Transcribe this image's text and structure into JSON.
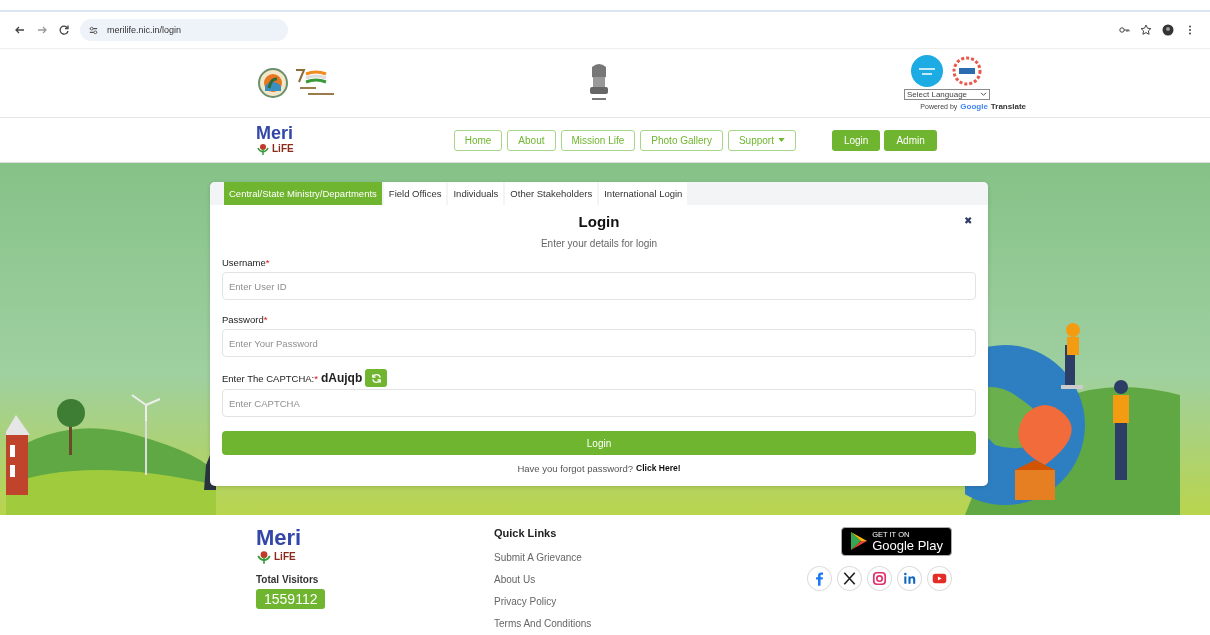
{
  "browser": {
    "url": "merilife.nic.in/login"
  },
  "header": {
    "language_select": {
      "value": "Select Language"
    },
    "powered_by": "Powered by",
    "google": "Google",
    "translate": "Translate"
  },
  "navbar": {
    "brand": {
      "line_1": "Meri",
      "line_2": "LiFE"
    },
    "menu": [
      {
        "label": "Home",
        "kind": "link"
      },
      {
        "label": "About",
        "kind": "link"
      },
      {
        "label": "Mission Life",
        "kind": "link"
      },
      {
        "label": "Photo Gallery",
        "kind": "link"
      },
      {
        "label": "Support",
        "kind": "dropdown"
      }
    ],
    "actions": [
      "Login",
      "Admin"
    ]
  },
  "tabs": [
    {
      "label": "Central/State Ministry/Departments",
      "selected": true
    },
    {
      "label": "Field Offices",
      "selected": false
    },
    {
      "label": "Individuals",
      "selected": false
    },
    {
      "label": "Other Stakeholders",
      "selected": false
    },
    {
      "label": "International Login",
      "selected": false
    }
  ],
  "login": {
    "title": "Login",
    "close": "✖",
    "subtitle": "Enter your details for login",
    "fields": [
      {
        "label": "Username",
        "required_mark": "*",
        "placeholder": "Enter User ID"
      },
      {
        "label": "Password",
        "required_mark": "*",
        "placeholder": "Enter Your Password"
      }
    ],
    "captcha": {
      "label": "Enter The CAPTCHA:",
      "required_mark": "*",
      "code": "dAujqb",
      "placeholder": "Enter CAPTCHA"
    },
    "submit": "Login",
    "forgot_text": "Have you forgot password?",
    "forgot_link": "Click Here!"
  },
  "footer": {
    "brand": {
      "line_1": "Meri",
      "line_2": "LiFE"
    },
    "visitors_label": "Total Visitors",
    "visitors_count": "1559112",
    "quick_links_title": "Quick Links",
    "quick_links": [
      "Submit A Grievance",
      "About Us",
      "Privacy Policy",
      "Terms And Conditions"
    ],
    "play_badge": {
      "small": "GET IT ON",
      "large": "Google Play"
    },
    "socials": [
      {
        "kind": "facebook"
      },
      {
        "kind": "x"
      },
      {
        "kind": "instagram"
      },
      {
        "kind": "linkedin"
      },
      {
        "kind": "youtube"
      }
    ]
  }
}
